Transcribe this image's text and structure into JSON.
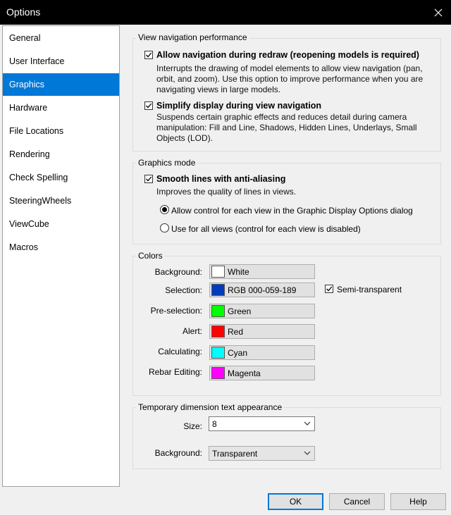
{
  "window": {
    "title": "Options"
  },
  "sidebar": {
    "items": [
      {
        "label": "General"
      },
      {
        "label": "User Interface"
      },
      {
        "label": "Graphics",
        "selected": true
      },
      {
        "label": "Hardware"
      },
      {
        "label": "File Locations"
      },
      {
        "label": "Rendering"
      },
      {
        "label": "Check Spelling"
      },
      {
        "label": "SteeringWheels"
      },
      {
        "label": "ViewCube"
      },
      {
        "label": "Macros"
      }
    ]
  },
  "nav_perf": {
    "label": "View navigation performance",
    "allow_nav": {
      "label": "Allow navigation during redraw (reopening models is required)",
      "checked": true,
      "desc": [
        "Interrupts the drawing of model elements to allow view navigation (pan,",
        "orbit, and zoom). Use this option to improve performance when you are",
        "navigating views in large models."
      ]
    },
    "simplify": {
      "label": "Simplify display during view navigation",
      "checked": true,
      "desc": [
        "Suspends certain graphic effects and reduces detail during camera",
        "manipulation: Fill and Line, Shadows, Hidden Lines, Underlays, Small",
        "Objects (LOD)."
      ]
    }
  },
  "graphics_mode": {
    "label": "Graphics mode",
    "smooth": {
      "label": "Smooth lines with anti-aliasing",
      "checked": true,
      "desc": "Improves the quality of lines in views."
    },
    "radio_each": {
      "label": "Allow control for each view in the Graphic Display Options dialog",
      "selected": true
    },
    "radio_all": {
      "label": "Use for all views (control for each view is disabled)",
      "selected": false
    }
  },
  "colors": {
    "label": "Colors",
    "rows": [
      {
        "label": "Background:",
        "value": "White",
        "color": "#ffffff"
      },
      {
        "label": "Selection:",
        "value": "RGB 000-059-189",
        "color": "#003bbd"
      },
      {
        "label": "Pre-selection:",
        "value": "Green",
        "color": "#00ff00"
      },
      {
        "label": "Alert:",
        "value": "Red",
        "color": "#ff0000"
      },
      {
        "label": "Calculating:",
        "value": "Cyan",
        "color": "#00ffff"
      },
      {
        "label": "Rebar Editing:",
        "value": "Magenta",
        "color": "#ff00ff"
      }
    ],
    "semi_transparent": {
      "label": "Semi-transparent",
      "checked": true
    }
  },
  "temp_dim": {
    "label": "Temporary dimension text appearance",
    "size": {
      "label": "Size:",
      "value": "8"
    },
    "background": {
      "label": "Background:",
      "value": "Transparent"
    }
  },
  "buttons": {
    "ok": "OK",
    "cancel": "Cancel",
    "help": "Help"
  },
  "accent_color": "#0078d7"
}
